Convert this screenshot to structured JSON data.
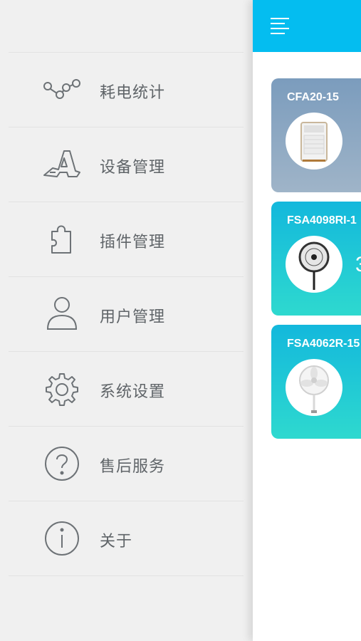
{
  "menu": {
    "items": [
      {
        "label": "耗电统计",
        "icon": "power-stats-icon"
      },
      {
        "label": "设备管理",
        "icon": "device-manage-icon"
      },
      {
        "label": "插件管理",
        "icon": "plugin-puzzle-icon"
      },
      {
        "label": "用户管理",
        "icon": "user-icon"
      },
      {
        "label": "系统设置",
        "icon": "gear-icon"
      },
      {
        "label": "售后服务",
        "icon": "help-icon"
      },
      {
        "label": "关于",
        "icon": "info-icon"
      }
    ]
  },
  "header": {
    "menu_icon": "hamburger-menu-icon"
  },
  "devices": [
    {
      "name": "CFA20-15",
      "image": "air-cooler-image",
      "extra": ""
    },
    {
      "name": "FSA4098RI-1",
      "image": "dark-stand-fan-image",
      "extra": "3"
    },
    {
      "name": "FSA4062R-15",
      "image": "white-stand-fan-image",
      "extra": ""
    }
  ],
  "colors": {
    "accent": "#04bdf0",
    "card_grey_top": "#7b9cbd",
    "card_grey_bottom": "#9fb4c8",
    "card_teal_top": "#13b8dc",
    "card_teal_bottom": "#2ed9cf",
    "menu_text": "#5f6468",
    "drawer_bg": "#f0f0f0"
  }
}
